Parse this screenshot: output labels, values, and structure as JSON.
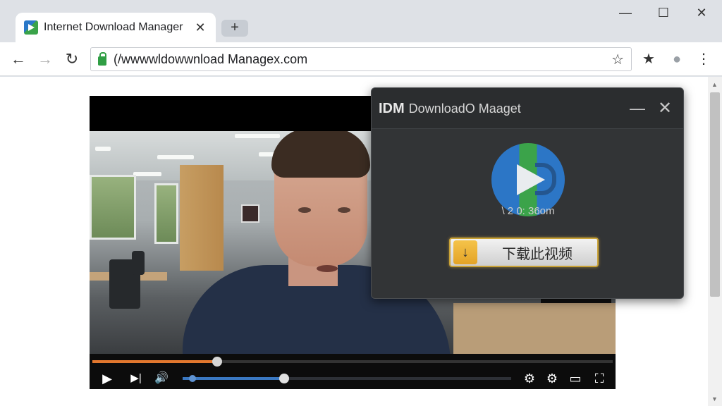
{
  "window": {
    "tab_title": "Internet Download Manager",
    "tab_close": "✕",
    "new_tab": "+",
    "minimize": "—",
    "maximize": "☐",
    "close": "✕"
  },
  "toolbar": {
    "back": "←",
    "forward": "→",
    "reload": "↻",
    "url": "(/wwwwldowwnload Managex.com",
    "bookmark_star": "☆",
    "bookmarks_icon": "★",
    "profile_icon": "●",
    "menu_icon": "⋮"
  },
  "player": {
    "progress_fraction": 0.24,
    "volume_fraction": 0.31,
    "volume_dot_fraction": 0.03,
    "controls": {
      "play": "▶",
      "next": "▶|",
      "volume": "🔊",
      "settings1": "⚙",
      "settings2": "⚙",
      "cast": "▭",
      "fullscreen": "⛶"
    }
  },
  "idm": {
    "brand": "IDM",
    "title": "DownloadO Maaget",
    "minimize": "—",
    "close": "✕",
    "meta": "\\ 2 0: 36om",
    "download_icon": "↓",
    "download_label": "下载此视频"
  },
  "colors": {
    "accent_orange": "#e2772e",
    "volume_blue": "#3a78c2",
    "idm_bg": "#323436",
    "button_border": "#c9a236"
  }
}
